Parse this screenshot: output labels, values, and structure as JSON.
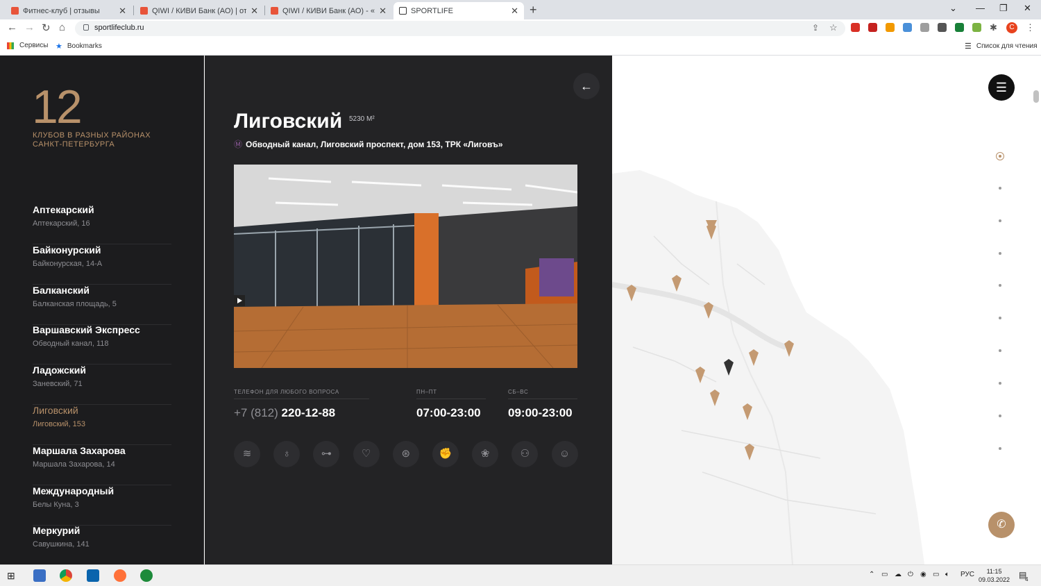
{
  "browser": {
    "tabs": [
      {
        "title": "Фитнес-клуб | отзывы",
        "active": false
      },
      {
        "title": "QIWI / КИВИ Банк (АО) | отзывы",
        "active": false
      },
      {
        "title": "QIWI / КИВИ Банк (АО) - «➤Кр",
        "active": false
      },
      {
        "title": "SPORTLIFE",
        "active": true
      }
    ],
    "url": "sportlifeclub.ru",
    "bookmarks": {
      "apps": "Сервисы",
      "bookmarks": "Bookmarks",
      "reading_list": "Список для чтения"
    },
    "profile_initial": "С"
  },
  "sidebar": {
    "count": "12",
    "count_caption": "КЛУБОВ В РАЗНЫХ РАЙОНАХ САНКТ-ПЕТЕРБУРГА",
    "clubs": [
      {
        "name": "Аптекарский",
        "address": "Аптекарский, 16"
      },
      {
        "name": "Байконурский",
        "address": "Байконурская, 14-А"
      },
      {
        "name": "Балканский",
        "address": "Балканская площадь, 5"
      },
      {
        "name": "Варшавский Экспресс",
        "address": "Обводный канал, 118"
      },
      {
        "name": "Ладожский",
        "address": "Заневский, 71"
      },
      {
        "name": "Лиговский",
        "address": "Лиговский, 153"
      },
      {
        "name": "Маршала Захарова",
        "address": "Маршала Захарова, 14"
      },
      {
        "name": "Международный",
        "address": "Белы Куна, 3"
      },
      {
        "name": "Меркурий",
        "address": "Савушкина, 141"
      }
    ],
    "active_index": 5
  },
  "club": {
    "name": "Лиговский",
    "area": "5230 М²",
    "metro_icon": "metro-icon",
    "address": "Обводный канал, Лиговский проспект, дом 153, ТРК «Лиговъ»",
    "phone_label": "ТЕЛЕФОН ДЛЯ ЛЮБОГО ВОПРОСА",
    "phone_prefix": "+7 (812)",
    "phone_number": "220-12-88",
    "weekday_label": "ПН–ПТ",
    "weekday_hours": "07:00-23:00",
    "weekend_label": "СБ–ВС",
    "weekend_hours": "09:00-23:00",
    "amenities": [
      "pool-icon",
      "kettlebell-icon",
      "dumbbell-icon",
      "cardio-icon",
      "ball-icon",
      "boxing-icon",
      "yoga-icon",
      "group-icon",
      "kids-icon"
    ]
  },
  "taskbar": {
    "lang": "РУС",
    "time": "11:15",
    "date": "09.03.2022",
    "notifications": "4"
  },
  "colors": {
    "accent": "#b8916a",
    "dark": "#1c1c1e",
    "panel": "#232325"
  }
}
